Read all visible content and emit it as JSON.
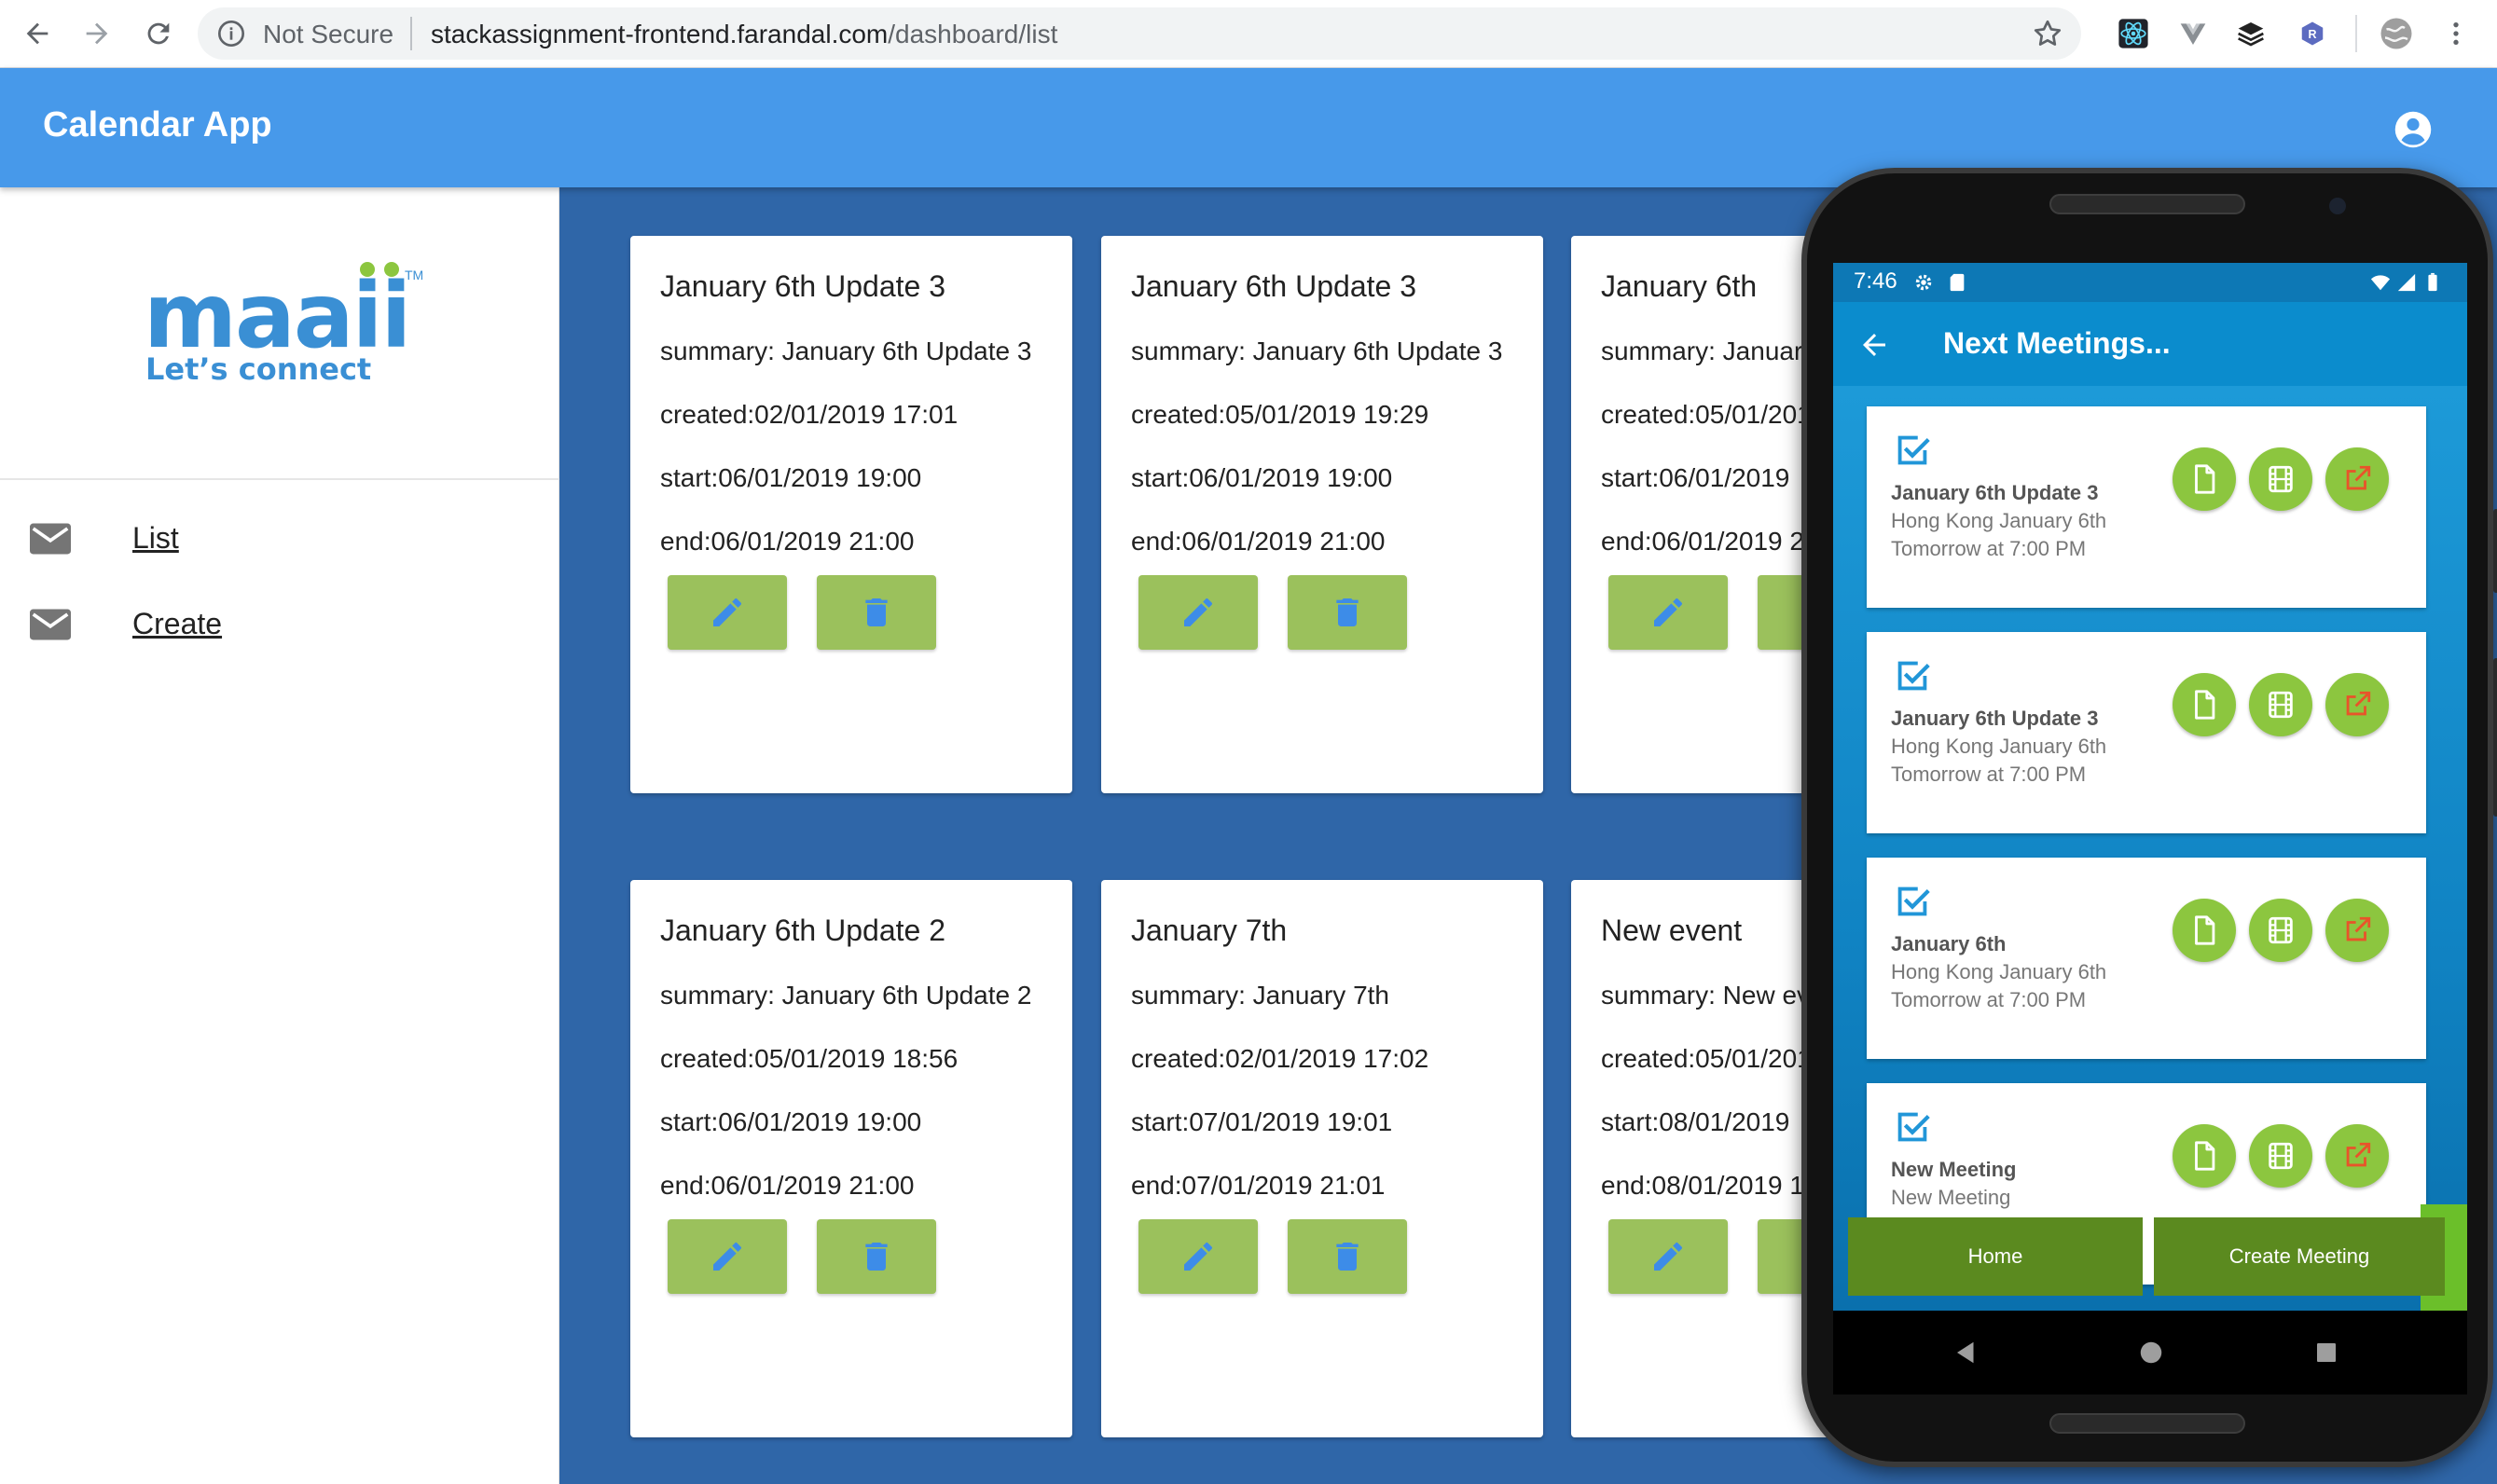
{
  "browser": {
    "security_label": "Not Secure",
    "url_host": "stackassignment-frontend.farandal.com",
    "url_path": "/dashboard/list"
  },
  "app": {
    "title": "Calendar App"
  },
  "sidebar": {
    "logo_text": "maaii",
    "logo_tagline": "Let’s connect",
    "logo_tm": "TM",
    "items": [
      {
        "label": "List",
        "icon": "mail-icon"
      },
      {
        "label": "Create",
        "icon": "mail-icon"
      }
    ]
  },
  "events": [
    {
      "title": "January 6th Update 3",
      "summary": "summary: January 6th Update 3",
      "created": "created:02/01/2019 17:01",
      "start": "start:06/01/2019 19:00",
      "end": "end:06/01/2019 21:00"
    },
    {
      "title": "January 6th Update 3",
      "summary": "summary: January 6th Update 3",
      "created": "created:05/01/2019 19:29",
      "start": "start:06/01/2019 19:00",
      "end": "end:06/01/2019 21:00"
    },
    {
      "title": "January 6th",
      "summary": "summary: January 6th",
      "created": "created:05/01/2019",
      "start": "start:06/01/2019",
      "end": "end:06/01/2019 21:00"
    },
    {
      "title": "January 6th Update 2",
      "summary": "summary: January 6th Update 2",
      "created": "created:05/01/2019 18:56",
      "start": "start:06/01/2019 19:00",
      "end": "end:06/01/2019 21:00"
    },
    {
      "title": "January 7th",
      "summary": "summary: January 7th",
      "created": "created:02/01/2019 17:02",
      "start": "start:07/01/2019 19:01",
      "end": "end:07/01/2019 21:01"
    },
    {
      "title": "New event",
      "summary": "summary: New event",
      "created": "created:05/01/2019",
      "start": "start:08/01/2019",
      "end": "end:08/01/2019 1"
    }
  ],
  "phone": {
    "status_time": "7:46",
    "toolbar_title": "Next Meetings...",
    "meetings": [
      {
        "title": "January 6th Update 3",
        "location": "Hong Kong January 6th",
        "time": "Tomorrow at 7:00 PM"
      },
      {
        "title": "January 6th Update 3",
        "location": "Hong Kong January 6th",
        "time": "Tomorrow at 7:00 PM"
      },
      {
        "title": "January 6th",
        "location": "Hong Kong January 6th",
        "time": "Tomorrow at 7:00 PM"
      },
      {
        "title": "New Meeting",
        "location": "New Meeting",
        "time": ""
      }
    ],
    "tab_home": "Home",
    "tab_create": "Create Meeting"
  },
  "colors": {
    "app_bar": "#4799ea",
    "main_bg": "#2f66a8",
    "card_button": "#9bc15c",
    "phone_accent": "#0b8ccd",
    "meeting_button": "#8cc63f",
    "tab_green": "#5b8a1f"
  }
}
